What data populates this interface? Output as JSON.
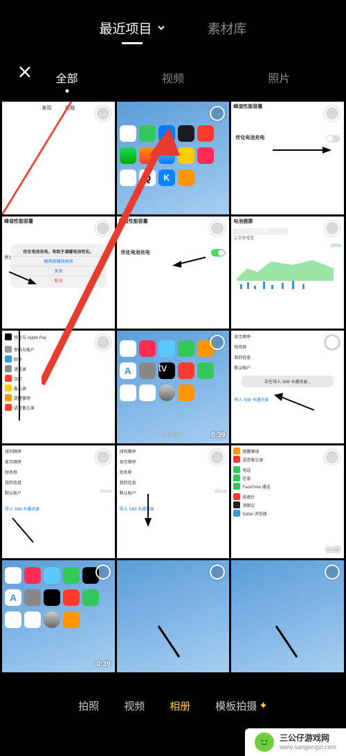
{
  "header": {
    "album_tab": "最近项目",
    "material_tab": "素材库"
  },
  "filters": {
    "all": "全部",
    "video": "视频",
    "photo": "照片"
  },
  "bottom": {
    "camera": "拍照",
    "video": "视频",
    "album": "相册",
    "template": "模板拍摄"
  },
  "thumbs": {
    "t1": {
      "label1": "发现",
      "label2": "模版"
    },
    "t3": {
      "title": "峰值性能容量",
      "opt": "优化电池充电"
    },
    "t4": {
      "title": "峰值性能容量",
      "opt_title": "优化电池充电。有助于减缓电池老化。",
      "keep_off": "明天前保持关闭",
      "close": "关闭",
      "cancel": "取消",
      "prefix": "优化电"
    },
    "t5": {
      "title": "峰值性能容量",
      "opt": "优化电池充电"
    },
    "t6": {
      "title": "电池健康",
      "last24": "过去24小时",
      "last10": "过去10天",
      "last_charge": "上次充电至",
      "percent": "100%"
    },
    "t7": {
      "wallet": "钱包与 Apple Pay",
      "accounts": "密码与帐户",
      "mail": "邮件",
      "contacts": "通讯录",
      "calendar": "日历",
      "notes": "备忘录",
      "reminders": "提醒事项",
      "voice": "语音备忘录"
    },
    "t8": {
      "no_photos": "没有照片",
      "duration": "0:39"
    },
    "t9": {
      "order": "显示顺序",
      "short": "短名称",
      "mine": "我的信息",
      "default": "默认帐户",
      "importing": "正在导入 SIM 卡通讯录...",
      "import_sim": "导入 SIM 卡通讯录"
    },
    "t10": {
      "arrange": "排列顺序",
      "order": "显示顺序",
      "short": "短名称",
      "mine": "我的信息",
      "default": "默认帐户",
      "cloud": "iCloud",
      "import_sim": "导入 SIM 卡通讯录"
    },
    "t11": {
      "arrange": "排列顺序",
      "order": "显示顺序",
      "short": "短名称",
      "mine": "我的信息",
      "default": "默认帐户",
      "cloud": "iCloud",
      "import_sim": "导入 SIM 卡通讯录"
    },
    "t12": {
      "reminders": "提醒事项",
      "voice": "语音备忘录",
      "phone": "电话",
      "msg": "信息",
      "ft": "FaceTime 通话",
      "compass": "指南针",
      "measure": "测距仪",
      "safari": "Safari 浏览器",
      "duration": "0:39"
    },
    "t13": {
      "duration": "0:39"
    }
  },
  "watermark": {
    "name": "三公仔游戏网",
    "url": "www.sangongzi.com"
  }
}
